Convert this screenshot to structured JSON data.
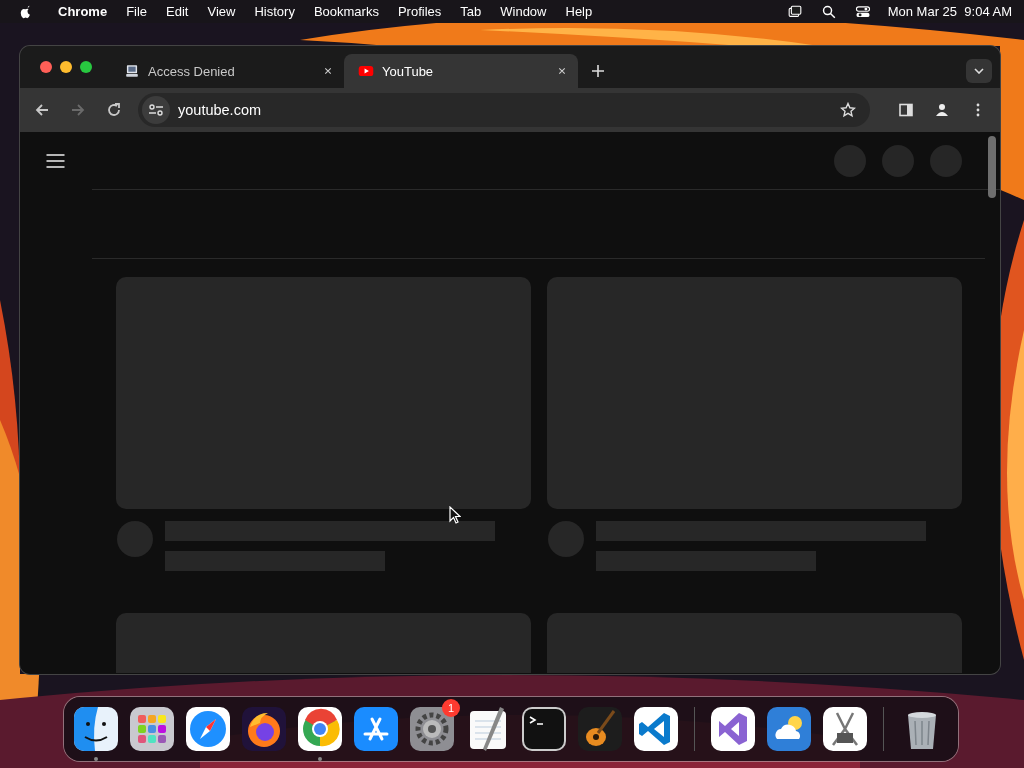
{
  "menu_bar": {
    "app_name": "Chrome",
    "menus": [
      "File",
      "Edit",
      "View",
      "History",
      "Bookmarks",
      "Profiles",
      "Tab",
      "Window",
      "Help"
    ],
    "clock": "Mon Mar 25  9:04 AM"
  },
  "tabs": [
    {
      "title": "Access Denied",
      "kind": "computer",
      "selected": false
    },
    {
      "title": "YouTube",
      "kind": "play",
      "selected": true
    }
  ],
  "address_bar": {
    "value": "youtube.com"
  },
  "dock": [
    {
      "kind": "finder",
      "running": true
    },
    {
      "kind": "launchpad",
      "running": false
    },
    {
      "kind": "safari",
      "running": false
    },
    {
      "kind": "firefox",
      "running": false
    },
    {
      "kind": "chrome",
      "running": true
    },
    {
      "kind": "appstore",
      "running": false
    },
    {
      "kind": "settings",
      "running": false,
      "badge": "1"
    },
    {
      "kind": "textedit",
      "running": false
    },
    {
      "kind": "terminal",
      "running": false
    },
    {
      "kind": "garageband",
      "running": false
    },
    {
      "kind": "vscode",
      "running": false
    },
    {
      "kind": "divider"
    },
    {
      "kind": "visualstudio",
      "running": false
    },
    {
      "kind": "weather",
      "running": false
    },
    {
      "kind": "caliper",
      "running": false
    },
    {
      "kind": "divider"
    },
    {
      "kind": "trash",
      "running": false
    }
  ]
}
